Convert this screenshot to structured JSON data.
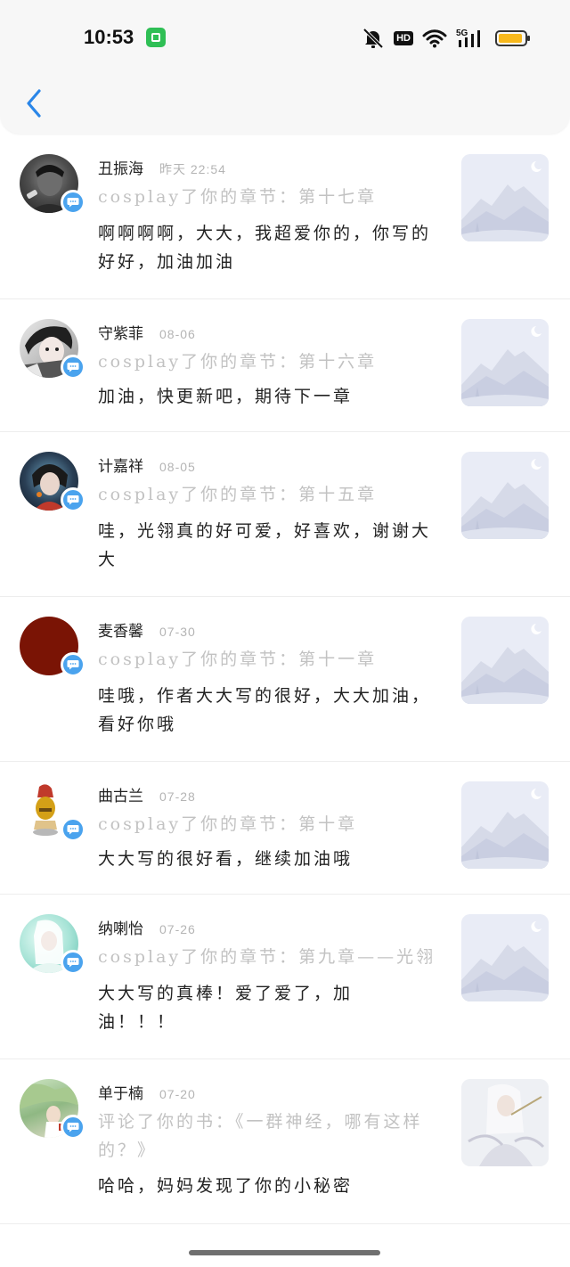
{
  "status": {
    "time": "10:53",
    "hd": "HD",
    "network": "5G"
  },
  "colors": {
    "accent": "#2a86e8",
    "badge": "#4aa3ee",
    "muted": "#c2c2c2"
  },
  "comments": [
    {
      "name": "丑振海",
      "date": "昨天 22:54",
      "reference": "cosplay了你的章节：第十七章",
      "text": "啊啊啊啊，大大，我超爱你的，你写的好好，加油加油"
    },
    {
      "name": "守紫菲",
      "date": "08-06",
      "reference": "cosplay了你的章节：第十六章",
      "text": "加油，快更新吧，期待下一章"
    },
    {
      "name": "计嘉祥",
      "date": "08-05",
      "reference": "cosplay了你的章节：第十五章",
      "text": "哇，光翎真的好可爱，好喜欢，谢谢大大"
    },
    {
      "name": "麦香馨",
      "date": "07-30",
      "reference": "cosplay了你的章节：第十一章",
      "text": "哇哦，作者大大写的很好，大大加油，看好你哦"
    },
    {
      "name": "曲古兰",
      "date": "07-28",
      "reference": "cosplay了你的章节：第十章",
      "text": "大大写的很好看，继续加油哦"
    },
    {
      "name": "纳喇怡",
      "date": "07-26",
      "reference": "cosplay了你的章节：第九章——光翎",
      "text": "大大写的真棒！爱了爱了，加油！！！"
    },
    {
      "name": "单于楠",
      "date": "07-20",
      "reference": "评论了你的书：《一群神经，哪有这样的？》",
      "text": "哈哈，妈妈发现了你的小秘密"
    }
  ]
}
